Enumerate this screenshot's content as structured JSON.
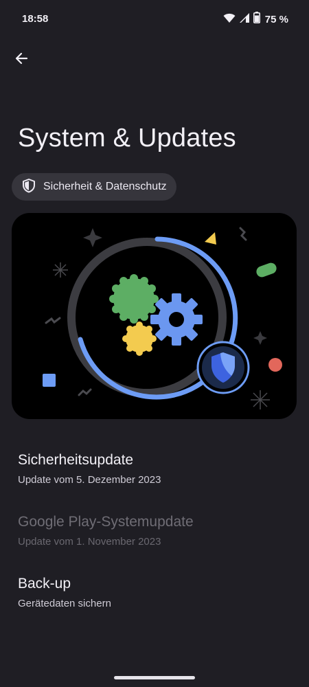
{
  "status_bar": {
    "time": "18:58",
    "battery_text": "75 %",
    "icons": [
      "wifi-icon",
      "signal-icon",
      "battery-icon"
    ]
  },
  "header": {
    "back_icon": "arrow-left-icon",
    "title": "System & Updates"
  },
  "chip": {
    "icon": "shield-icon",
    "label": "Sicherheit & Datenschutz"
  },
  "hero": {
    "illustration": "security-update-illustration",
    "colors": {
      "background": "#000000",
      "ring": "#6d9cf5",
      "gear_blue": "#6b97f0",
      "gear_green": "#5dae64",
      "gear_yellow": "#f3cb4f",
      "accent_red": "#e2675b"
    }
  },
  "items": [
    {
      "title": "Sicherheitsupdate",
      "subtitle": "Update vom 5. Dezember 2023",
      "enabled": true
    },
    {
      "title": "Google Play-Systemupdate",
      "subtitle": "Update vom 1. November 2023",
      "enabled": false
    },
    {
      "title": "Back-up",
      "subtitle": "Gerätedaten sichern",
      "enabled": true
    }
  ],
  "colors": {
    "background": "#1f1e24",
    "chip_background": "#36353c",
    "text_primary": "#f2f0f6",
    "text_disabled": "#6f6d75"
  }
}
